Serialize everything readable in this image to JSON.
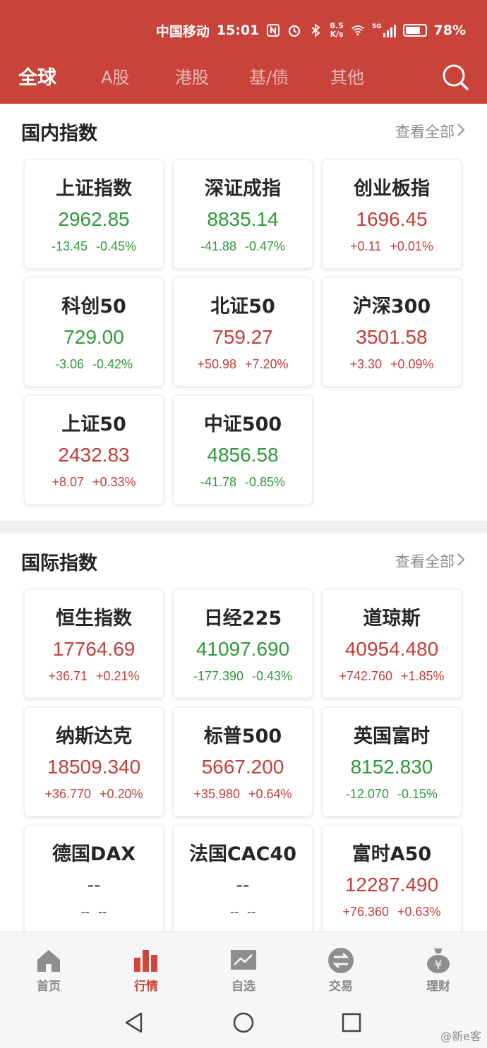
{
  "status_bar": {
    "carrier": "中国移动",
    "time": "15:01",
    "net_speed_value": "8.5",
    "net_speed_unit": "K/s",
    "signal_label": "5G",
    "battery_level": 0.78,
    "battery_text": "78%"
  },
  "top_tabs": [
    {
      "label": "全球",
      "active": true
    },
    {
      "label": "A股",
      "active": false
    },
    {
      "label": "港股",
      "active": false
    },
    {
      "label": "基/债",
      "active": false
    },
    {
      "label": "其他",
      "active": false
    }
  ],
  "domestic": {
    "title": "国内指数",
    "view_all": "查看全部",
    "cards": [
      {
        "name": "上证指数",
        "price": "2962.85",
        "change": "-13.45",
        "pct": "-0.45%",
        "dir": "down"
      },
      {
        "name": "深证成指",
        "price": "8835.14",
        "change": "-41.88",
        "pct": "-0.47%",
        "dir": "down"
      },
      {
        "name": "创业板指",
        "price": "1696.45",
        "change": "+0.11",
        "pct": "+0.01%",
        "dir": "up"
      },
      {
        "name": "科创50",
        "price": "729.00",
        "change": "-3.06",
        "pct": "-0.42%",
        "dir": "down"
      },
      {
        "name": "北证50",
        "price": "759.27",
        "change": "+50.98",
        "pct": "+7.20%",
        "dir": "up"
      },
      {
        "name": "沪深300",
        "price": "3501.58",
        "change": "+3.30",
        "pct": "+0.09%",
        "dir": "up"
      },
      {
        "name": "上证50",
        "price": "2432.83",
        "change": "+8.07",
        "pct": "+0.33%",
        "dir": "up"
      },
      {
        "name": "中证500",
        "price": "4856.58",
        "change": "-41.78",
        "pct": "-0.85%",
        "dir": "down"
      }
    ]
  },
  "international": {
    "title": "国际指数",
    "view_all": "查看全部",
    "cards": [
      {
        "name": "恒生指数",
        "price": "17764.69",
        "change": "+36.71",
        "pct": "+0.21%",
        "dir": "up"
      },
      {
        "name": "日经225",
        "price": "41097.690",
        "change": "-177.390",
        "pct": "-0.43%",
        "dir": "down"
      },
      {
        "name": "道琼斯",
        "price": "40954.480",
        "change": "+742.760",
        "pct": "+1.85%",
        "dir": "up"
      },
      {
        "name": "纳斯达克",
        "price": "18509.340",
        "change": "+36.770",
        "pct": "+0.20%",
        "dir": "up"
      },
      {
        "name": "标普500",
        "price": "5667.200",
        "change": "+35.980",
        "pct": "+0.64%",
        "dir": "up"
      },
      {
        "name": "英国富时",
        "price": "8152.830",
        "change": "-12.070",
        "pct": "-0.15%",
        "dir": "down"
      },
      {
        "name": "德国DAX",
        "price": "--",
        "change": "--",
        "pct": "--",
        "dir": "flat"
      },
      {
        "name": "法国CAC40",
        "price": "--",
        "change": "--",
        "pct": "--",
        "dir": "flat"
      },
      {
        "name": "富时A50",
        "price": "12287.490",
        "change": "+76.360",
        "pct": "+0.63%",
        "dir": "up"
      }
    ]
  },
  "bottom_nav": [
    {
      "label": "首页",
      "icon": "home-icon",
      "active": false
    },
    {
      "label": "行情",
      "icon": "market-bars-icon",
      "active": true
    },
    {
      "label": "自选",
      "icon": "watchlist-chart-icon",
      "active": false
    },
    {
      "label": "交易",
      "icon": "trade-exchange-icon",
      "active": false
    },
    {
      "label": "理财",
      "icon": "wealth-bag-icon",
      "active": false
    }
  ],
  "watermark": "@新e客",
  "colors": {
    "brand_red": "#c8443a",
    "up": "#c2403a",
    "down": "#2f9a3b",
    "nav_active": "#d2453b"
  }
}
